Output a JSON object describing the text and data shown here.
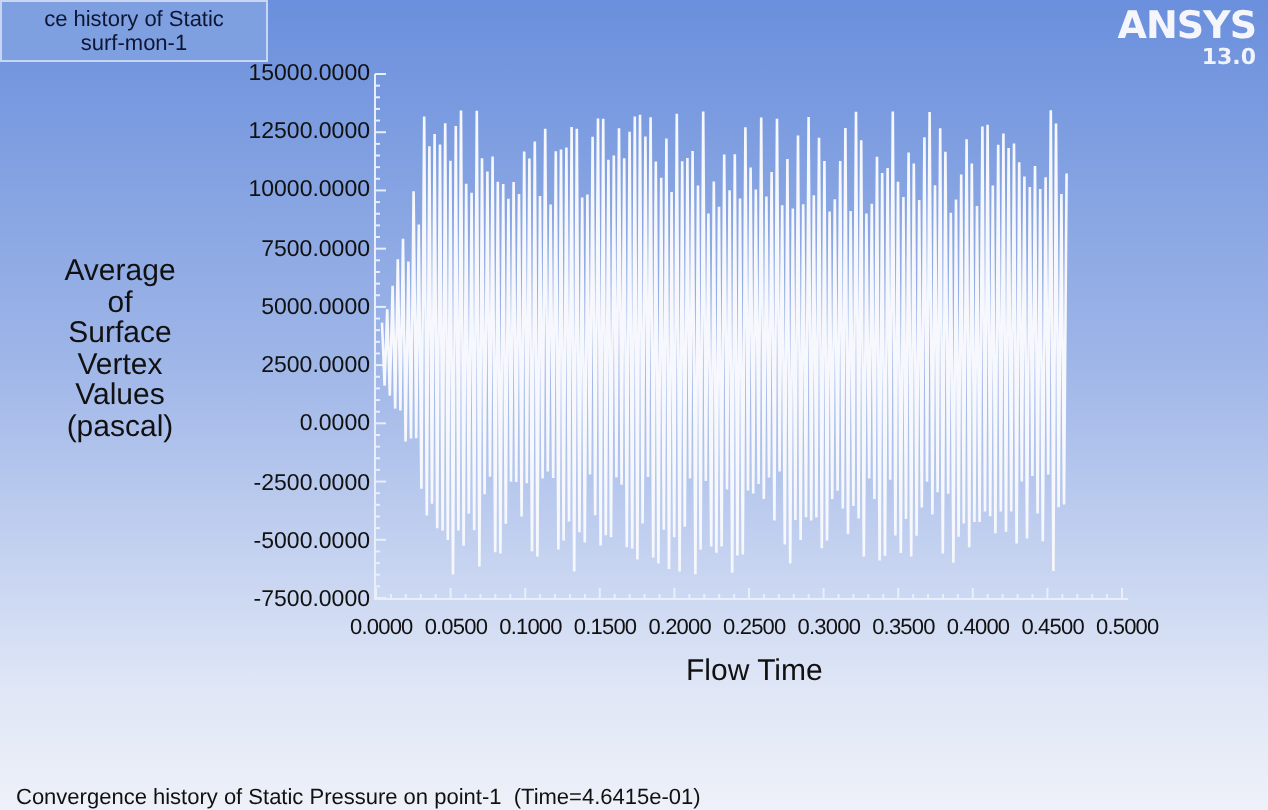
{
  "plot_title": {
    "lines": [
      "ce history of Static",
      "surf-mon-1"
    ]
  },
  "logo": {
    "brand": "ANSYS",
    "version": "13.0"
  },
  "y_axis": {
    "label_lines": [
      "Average",
      "of",
      "Surface",
      "Vertex",
      "Values",
      "(pascal)"
    ],
    "ticks": [
      "15000.0000",
      "12500.0000",
      "10000.0000",
      "7500.0000",
      "5000.0000",
      "2500.0000",
      "0.0000",
      "-2500.0000",
      "-5000.0000",
      "-7500.0000"
    ]
  },
  "x_axis": {
    "label": "Flow Time",
    "ticks": [
      "0.0000",
      "0.0500",
      "0.1000",
      "0.1500",
      "0.2000",
      "0.2500",
      "0.3000",
      "0.3500",
      "0.4000",
      "0.4500",
      "0.5000"
    ]
  },
  "caption": "Convergence history of Static Pressure on point-1  (Time=4.6415e-01)"
}
